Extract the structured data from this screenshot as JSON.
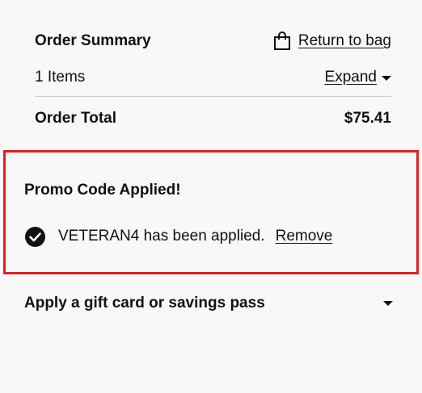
{
  "order_summary": {
    "title": "Order Summary",
    "return_link_label": "Return to bag",
    "items_count_label": "1 Items",
    "expand_label": "Expand",
    "total_label": "Order Total",
    "total_value": "$75.41"
  },
  "promo": {
    "title": "Promo Code Applied!",
    "applied_message": "VETERAN4 has been applied.",
    "remove_label": "Remove",
    "highlight_color": "#e02020"
  },
  "gift_card": {
    "label": "Apply a gift card or savings pass"
  },
  "icons": {
    "bag": "shopping-bag-icon",
    "expand": "caret-down-icon",
    "check": "check-circle-icon",
    "gift_toggle": "caret-down-icon"
  }
}
